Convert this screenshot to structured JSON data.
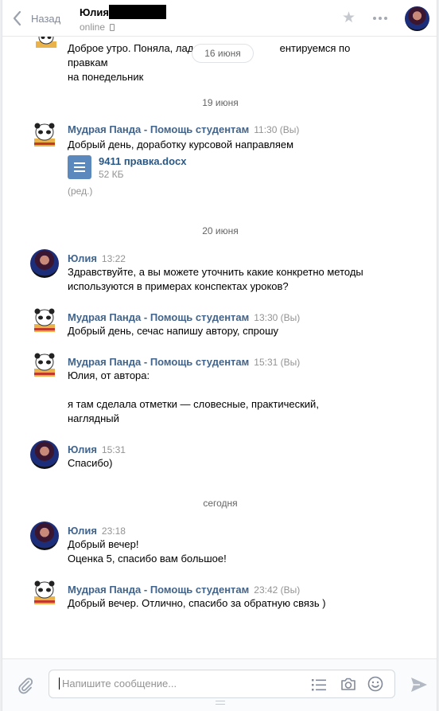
{
  "header": {
    "back_label": "Назад",
    "peer_name": "Юлия",
    "peer_status": "online"
  },
  "dates": {
    "floating": "16 июня",
    "d1": "19 июня",
    "d2": "20 июня",
    "d3": "сегодня"
  },
  "top_fragment": {
    "text": "Доброе утро. Поняла, лад                              ентируемся по правкам\nна понедельник"
  },
  "messages": [
    {
      "author": "Мудрая Панда - Помощь студентам",
      "time": "11:30 (Вы)",
      "text": "Добрый день, доработку курсовой направляем",
      "attachment": {
        "name": "9411 правка.docx",
        "size": "52 КБ"
      },
      "edited": "(ред.)"
    },
    {
      "author": "Юлия",
      "time": "13:22",
      "text": "Здравствуйте, а вы можете уточнить какие конкретно методы\nиспользуются в примерах конспектах уроков?"
    },
    {
      "author": "Мудрая Панда - Помощь студентам",
      "time": "13:30 (Вы)",
      "text": "Добрый день, сечас напишу автору, спрошу"
    },
    {
      "author": "Мудрая Панда - Помощь студентам",
      "time": "15:31 (Вы)",
      "text": "Юлия, от автора:\n\nя там сделала отметки — словесные, практический,\nнаглядный"
    },
    {
      "author": "Юлия",
      "time": "15:31",
      "text": "Спасибо)"
    },
    {
      "author": "Юлия",
      "time": "23:18",
      "text": "Добрый вечер!\nОценка 5, спасибо вам большое!"
    },
    {
      "author": "Мудрая Панда - Помощь студентам",
      "time": "23:42 (Вы)",
      "text": "Добрый вечер. Отлично, спасибо за обратную связь )"
    }
  ],
  "composer": {
    "placeholder": "Напишите сообщение..."
  },
  "icons": {
    "back": "chevron-left-icon",
    "star": "star-icon",
    "more": "more-dots-icon",
    "attach": "paperclip-icon",
    "templates": "list-icon",
    "camera": "camera-icon",
    "emoji": "smile-icon",
    "send": "send-icon"
  },
  "colors": {
    "author_link": "#42648b",
    "doc_icon": "#5b88bd",
    "muted": "#939393"
  }
}
